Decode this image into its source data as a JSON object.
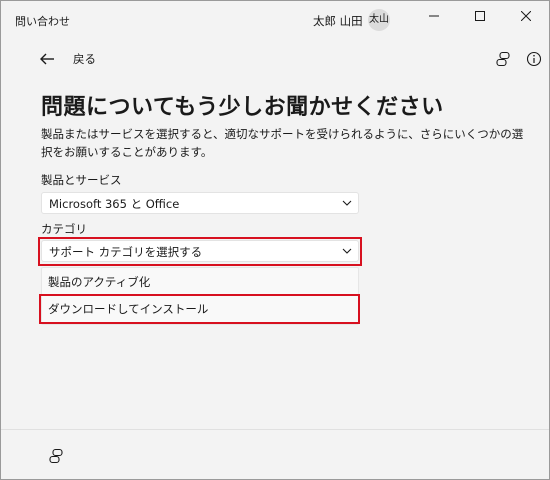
{
  "titlebar": {
    "app_title": "問い合わせ",
    "user_name": "太郎 山田",
    "avatar_text": "太山"
  },
  "nav": {
    "back_label": "戻る"
  },
  "main": {
    "title": "問題についてもう少しお聞かせください",
    "description": "製品またはサービスを選択すると、適切なサポートを受けられるように、さらにいくつかの選択をお願いすることがあります。",
    "product_label": "製品とサービス",
    "product_value": "Microsoft 365 と Office",
    "category_label": "カテゴリ",
    "category_value": "サポート カテゴリを選択する",
    "category_options": [
      "製品のアクティブ化",
      "ダウンロードしてインストール"
    ]
  },
  "colors": {
    "highlight": "#d7101f",
    "background": "#f3f3f3"
  },
  "icons": [
    "arrow-left-icon",
    "connect-icon",
    "info-icon",
    "chevron-down-icon",
    "minimize-icon",
    "maximize-icon",
    "close-icon"
  ]
}
